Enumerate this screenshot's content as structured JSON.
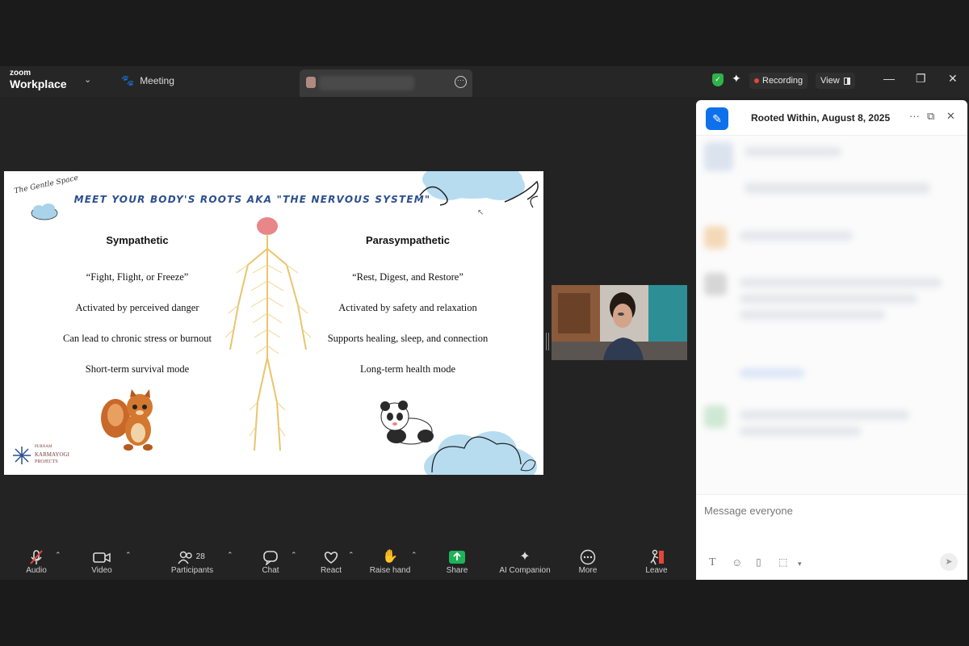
{
  "app": {
    "brand_small": "zoom",
    "brand_big": "Workplace",
    "meeting_tab": "Meeting"
  },
  "status": {
    "recording": "Recording",
    "view": "View"
  },
  "slide": {
    "logo_text": "The Gentle Space",
    "title": "MEET YOUR BODY'S ROOTS AKA \"THE NERVOUS SYSTEM\"",
    "left_heading": "Sympathetic",
    "left_items": [
      "“Fight, Flight, or Freeze”",
      "Activated by perceived danger",
      "Can lead to chronic stress or burnout",
      "Short-term survival mode"
    ],
    "right_heading": "Parasympathetic",
    "right_items": [
      "“Rest, Digest, and Restore”",
      "Activated by safety and relaxation",
      "Supports healing, sleep, and connection",
      "Long-term health mode"
    ],
    "footer_logo": [
      "PURNAM",
      "KARMAYOGI",
      "PROJECTS"
    ]
  },
  "toolbar": {
    "audio": "Audio",
    "video": "Video",
    "participants": "Participants",
    "participants_count": "28",
    "chat": "Chat",
    "react": "React",
    "raise_hand": "Raise hand",
    "share": "Share",
    "ai_companion": "AI Companion",
    "more": "More",
    "leave": "Leave"
  },
  "chat": {
    "title": "Rooted Within, August 8, 2025",
    "placeholder": "Message everyone"
  },
  "colors": {
    "accent": "#0e71eb",
    "share_green": "#1fb25a",
    "record_red": "#e5453b",
    "slide_title_blue": "#2b4f8f"
  }
}
